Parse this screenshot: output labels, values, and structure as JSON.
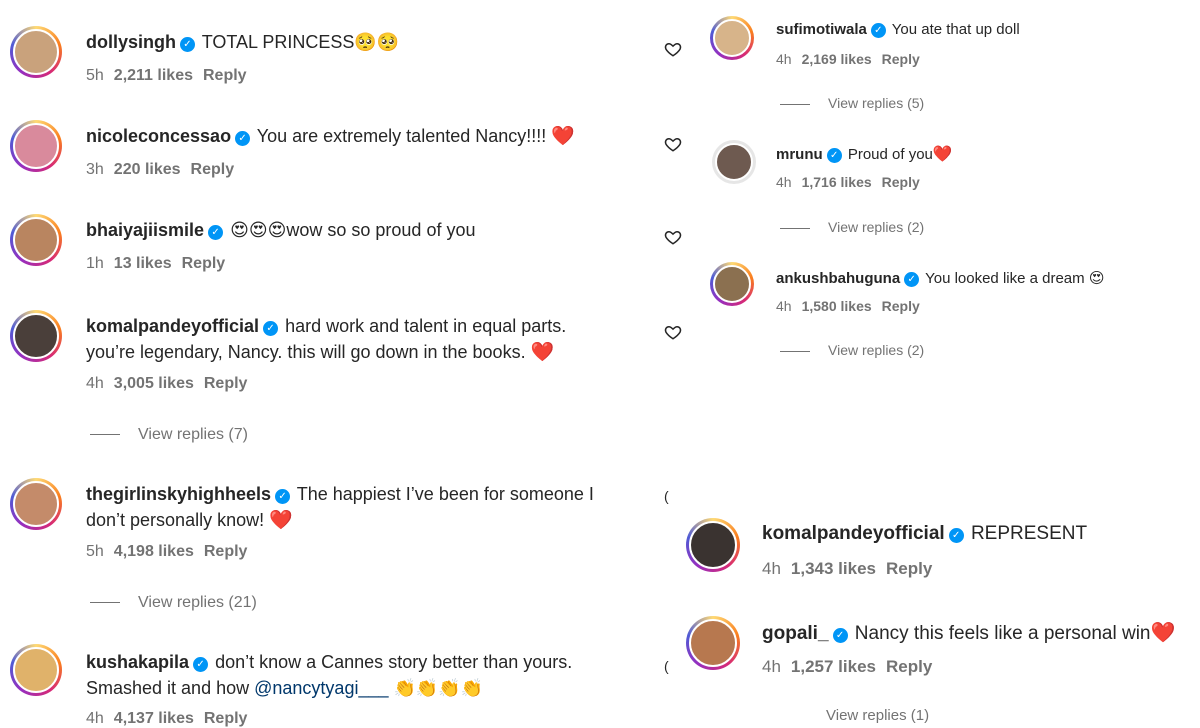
{
  "left": {
    "comments": [
      {
        "username": "dollysingh",
        "text": "TOTAL PRINCESS",
        "emoji": "🥺🥺",
        "time": "5h",
        "likes": "2,211 likes",
        "reply": "Reply",
        "avatar_color": "#c9a27c"
      },
      {
        "username": "nicoleconcessao",
        "text": "You are extremely talented Nancy!!!!",
        "emoji": "❤️",
        "time": "3h",
        "likes": "220 likes",
        "reply": "Reply",
        "avatar_color": "#d98a9c"
      },
      {
        "username": "bhaiyajiismile",
        "text": "wow so so proud of you",
        "emoji": "😍😍😍",
        "time": "1h",
        "likes": "13 likes",
        "reply": "Reply",
        "avatar_color": "#b98560"
      },
      {
        "username": "komalpandeyofficial",
        "text": "hard work and talent in equal parts.",
        "text2": "you’re legendary, Nancy. this will go down in the books.",
        "emoji": "❤️",
        "time": "4h",
        "likes": "3,005 likes",
        "reply": "Reply",
        "view_replies": "View replies (7)",
        "avatar_color": "#4a3f3a"
      },
      {
        "username": "thegirlinskyhighheels",
        "text": "The happiest I’ve been for someone I",
        "text2": "don’t personally know!",
        "emoji": "❤️",
        "time": "5h",
        "likes": "4,198 likes",
        "reply": "Reply",
        "view_replies": "View replies (21)",
        "avatar_color": "#c48b6a"
      },
      {
        "username": "kushakapila",
        "text": "don’t know a Cannes story better than yours.",
        "text2": "Smashed it and how",
        "mention": "@nancytyagi___",
        "emoji": "👏👏👏👏",
        "time": "4h",
        "likes": "4,137 likes",
        "reply": "Reply",
        "avatar_color": "#e0b26a"
      }
    ]
  },
  "right": {
    "comments": [
      {
        "username": "sufimotiwala",
        "text": "You ate that up doll",
        "time": "4h",
        "likes": "2,169 likes",
        "reply": "Reply",
        "view_replies": "View replies (5)",
        "avatar_color": "#d7b48a"
      },
      {
        "username": "mrunu",
        "text": "Proud of you",
        "emoji": "❤️",
        "time": "4h",
        "likes": "1,716 likes",
        "reply": "Reply",
        "view_replies": "View replies (2)",
        "avatar_color": "#6e5a50"
      },
      {
        "username": "ankushbahuguna",
        "text": "You looked like a dream",
        "emoji": "😍",
        "time": "4h",
        "likes": "1,580 likes",
        "reply": "Reply",
        "view_replies": "View replies (2)",
        "avatar_color": "#8b7050"
      }
    ]
  },
  "right_bottom": {
    "comments": [
      {
        "username": "komalpandeyofficial",
        "text": "REPRESENT",
        "time": "4h",
        "likes": "1,343 likes",
        "reply": "Reply",
        "avatar_color": "#3a3330"
      },
      {
        "username": "gopali_",
        "text": "Nancy this feels like a personal win",
        "emoji": "❤️",
        "time": "4h",
        "likes": "1,257 likes",
        "reply": "Reply",
        "view_replies": "View replies (1)",
        "avatar_color": "#b7784f"
      }
    ]
  },
  "icons": {
    "verified": "✓",
    "heart": "heart-outline-icon",
    "partial": "("
  }
}
